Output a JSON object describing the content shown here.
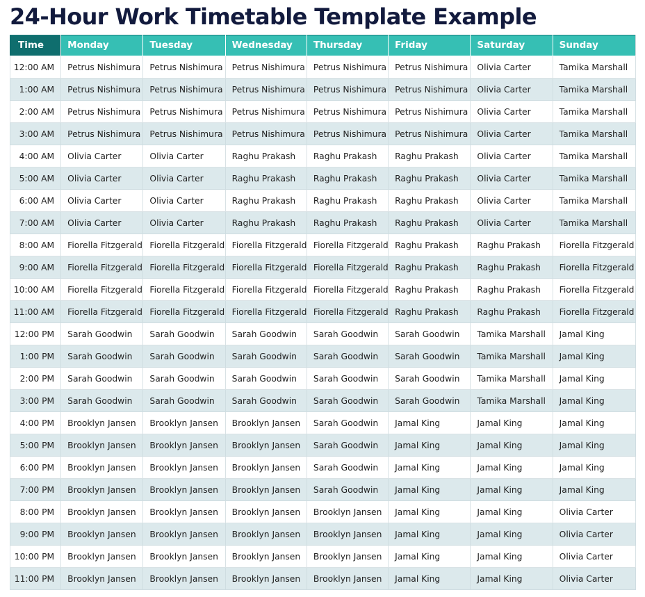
{
  "page": {
    "title": "24-Hour Work Timetable Template Example"
  },
  "colors": {
    "title_text": "#121a3d",
    "header_time_bg": "#0f6e6e",
    "header_day_bg": "#36bfb4",
    "header_text": "#ffffff",
    "row_alt_bg": "#dce9ec",
    "row_bg": "#ffffff",
    "cell_border": "#d9e2e5",
    "cell_text": "#222222"
  },
  "table": {
    "columns": [
      "Time",
      "Monday",
      "Tuesday",
      "Wednesday",
      "Thursday",
      "Friday",
      "Saturday",
      "Sunday"
    ],
    "rows": [
      {
        "time": "12:00 AM",
        "cells": [
          "Petrus Nishimura",
          "Petrus Nishimura",
          "Petrus Nishimura",
          "Petrus Nishimura",
          "Petrus Nishimura",
          "Olivia Carter",
          "Tamika Marshall"
        ]
      },
      {
        "time": "1:00 AM",
        "cells": [
          "Petrus Nishimura",
          "Petrus Nishimura",
          "Petrus Nishimura",
          "Petrus Nishimura",
          "Petrus Nishimura",
          "Olivia Carter",
          "Tamika Marshall"
        ]
      },
      {
        "time": "2:00 AM",
        "cells": [
          "Petrus Nishimura",
          "Petrus Nishimura",
          "Petrus Nishimura",
          "Petrus Nishimura",
          "Petrus Nishimura",
          "Olivia Carter",
          "Tamika Marshall"
        ]
      },
      {
        "time": "3:00 AM",
        "cells": [
          "Petrus Nishimura",
          "Petrus Nishimura",
          "Petrus Nishimura",
          "Petrus Nishimura",
          "Petrus Nishimura",
          "Olivia Carter",
          "Tamika Marshall"
        ]
      },
      {
        "time": "4:00 AM",
        "cells": [
          "Olivia Carter",
          "Olivia Carter",
          "Raghu Prakash",
          "Raghu Prakash",
          "Raghu Prakash",
          "Olivia Carter",
          "Tamika Marshall"
        ]
      },
      {
        "time": "5:00 AM",
        "cells": [
          "Olivia Carter",
          "Olivia Carter",
          "Raghu Prakash",
          "Raghu Prakash",
          "Raghu Prakash",
          "Olivia Carter",
          "Tamika Marshall"
        ]
      },
      {
        "time": "6:00 AM",
        "cells": [
          "Olivia Carter",
          "Olivia Carter",
          "Raghu Prakash",
          "Raghu Prakash",
          "Raghu Prakash",
          "Olivia Carter",
          "Tamika Marshall"
        ]
      },
      {
        "time": "7:00 AM",
        "cells": [
          "Olivia Carter",
          "Olivia Carter",
          "Raghu Prakash",
          "Raghu Prakash",
          "Raghu Prakash",
          "Olivia Carter",
          "Tamika Marshall"
        ]
      },
      {
        "time": "8:00 AM",
        "cells": [
          "Fiorella Fitzgerald",
          "Fiorella Fitzgerald",
          "Fiorella Fitzgerald",
          "Fiorella Fitzgerald",
          "Raghu Prakash",
          "Raghu Prakash",
          "Fiorella Fitzgerald"
        ]
      },
      {
        "time": "9:00 AM",
        "cells": [
          "Fiorella Fitzgerald",
          "Fiorella Fitzgerald",
          "Fiorella Fitzgerald",
          "Fiorella Fitzgerald",
          "Raghu Prakash",
          "Raghu Prakash",
          "Fiorella Fitzgerald"
        ]
      },
      {
        "time": "10:00 AM",
        "cells": [
          "Fiorella Fitzgerald",
          "Fiorella Fitzgerald",
          "Fiorella Fitzgerald",
          "Fiorella Fitzgerald",
          "Raghu Prakash",
          "Raghu Prakash",
          "Fiorella Fitzgerald"
        ]
      },
      {
        "time": "11:00 AM",
        "cells": [
          "Fiorella Fitzgerald",
          "Fiorella Fitzgerald",
          "Fiorella Fitzgerald",
          "Fiorella Fitzgerald",
          "Raghu Prakash",
          "Raghu Prakash",
          "Fiorella Fitzgerald"
        ]
      },
      {
        "time": "12:00 PM",
        "cells": [
          "Sarah Goodwin",
          "Sarah Goodwin",
          "Sarah Goodwin",
          "Sarah Goodwin",
          "Sarah Goodwin",
          "Tamika Marshall",
          "Jamal King"
        ]
      },
      {
        "time": "1:00 PM",
        "cells": [
          "Sarah Goodwin",
          "Sarah Goodwin",
          "Sarah Goodwin",
          "Sarah Goodwin",
          "Sarah Goodwin",
          "Tamika Marshall",
          "Jamal King"
        ]
      },
      {
        "time": "2:00 PM",
        "cells": [
          "Sarah Goodwin",
          "Sarah Goodwin",
          "Sarah Goodwin",
          "Sarah Goodwin",
          "Sarah Goodwin",
          "Tamika Marshall",
          "Jamal King"
        ]
      },
      {
        "time": "3:00 PM",
        "cells": [
          "Sarah Goodwin",
          "Sarah Goodwin",
          "Sarah Goodwin",
          "Sarah Goodwin",
          "Sarah Goodwin",
          "Tamika Marshall",
          "Jamal King"
        ]
      },
      {
        "time": "4:00 PM",
        "cells": [
          "Brooklyn Jansen",
          "Brooklyn Jansen",
          "Brooklyn Jansen",
          "Sarah Goodwin",
          "Jamal King",
          "Jamal King",
          "Jamal King"
        ]
      },
      {
        "time": "5:00 PM",
        "cells": [
          "Brooklyn Jansen",
          "Brooklyn Jansen",
          "Brooklyn Jansen",
          "Sarah Goodwin",
          "Jamal King",
          "Jamal King",
          "Jamal King"
        ]
      },
      {
        "time": "6:00 PM",
        "cells": [
          "Brooklyn Jansen",
          "Brooklyn Jansen",
          "Brooklyn Jansen",
          "Sarah Goodwin",
          "Jamal King",
          "Jamal King",
          "Jamal King"
        ]
      },
      {
        "time": "7:00 PM",
        "cells": [
          "Brooklyn Jansen",
          "Brooklyn Jansen",
          "Brooklyn Jansen",
          "Sarah Goodwin",
          "Jamal King",
          "Jamal King",
          "Jamal King"
        ]
      },
      {
        "time": "8:00 PM",
        "cells": [
          "Brooklyn Jansen",
          "Brooklyn Jansen",
          "Brooklyn Jansen",
          "Brooklyn Jansen",
          "Jamal King",
          "Jamal King",
          "Olivia Carter"
        ]
      },
      {
        "time": "9:00 PM",
        "cells": [
          "Brooklyn Jansen",
          "Brooklyn Jansen",
          "Brooklyn Jansen",
          "Brooklyn Jansen",
          "Jamal King",
          "Jamal King",
          "Olivia Carter"
        ]
      },
      {
        "time": "10:00 PM",
        "cells": [
          "Brooklyn Jansen",
          "Brooklyn Jansen",
          "Brooklyn Jansen",
          "Brooklyn Jansen",
          "Jamal King",
          "Jamal King",
          "Olivia Carter"
        ]
      },
      {
        "time": "11:00 PM",
        "cells": [
          "Brooklyn Jansen",
          "Brooklyn Jansen",
          "Brooklyn Jansen",
          "Brooklyn Jansen",
          "Jamal King",
          "Jamal King",
          "Olivia Carter"
        ]
      }
    ]
  }
}
